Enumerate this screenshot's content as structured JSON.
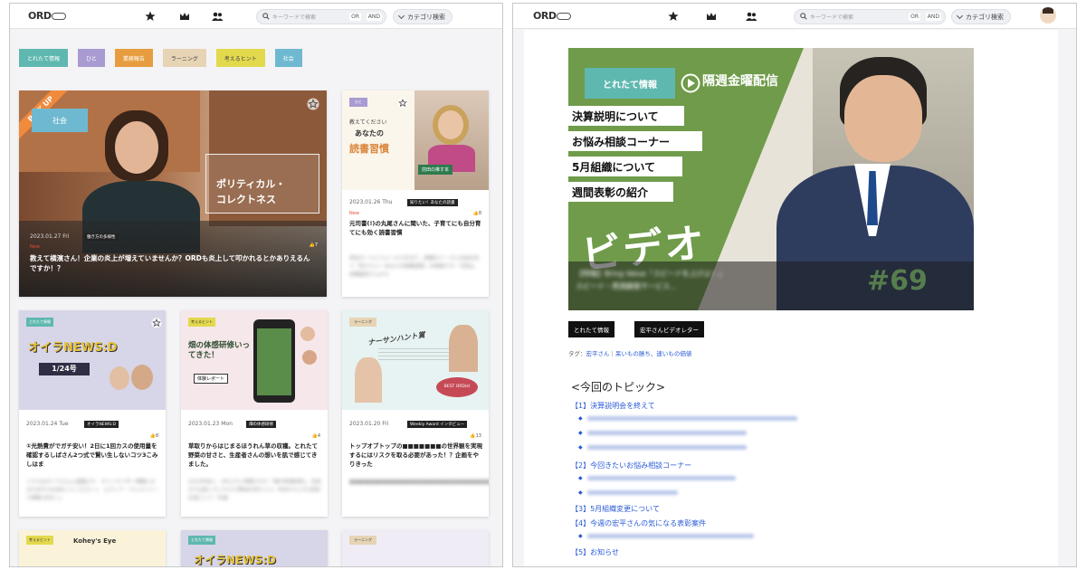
{
  "header": {
    "logo": "ORD",
    "search_placeholder": "キーワードで検索",
    "or_label": "OR",
    "and_label": "AND",
    "category_label": "カテゴリ検索"
  },
  "left": {
    "chips": [
      {
        "label": "とれたて情報",
        "color": "#5fb8b0"
      },
      {
        "label": "ひと",
        "color": "#a99bd1"
      },
      {
        "label": "業務報告",
        "color": "#e79d3f"
      },
      {
        "label": "ラーニング",
        "color": "#e7d4b5"
      },
      {
        "label": "考えるヒント",
        "color": "#e3d94d"
      },
      {
        "label": "社会",
        "color": "#6fb9d0"
      }
    ],
    "featured": {
      "pick_label": "PICK UP",
      "category": "社会",
      "thumb_text_1": "ポリティカル・",
      "thumb_text_2": "コレクトネス",
      "date": "2023.01.27 Fri",
      "tag": "働き方の多様性",
      "likes": "7",
      "new_label": "New",
      "title": "教えて横濱さん！企業の炎上が増えていませんか？ORDも炎上して叩かれるとかありえるんですか！？"
    },
    "side_card": {
      "category": "ひと",
      "thumb_text_1": "教えてください",
      "thumb_text_2": "あなたの",
      "thumb_text_3": "読書習慣",
      "thumb_badge": "前田の推す本",
      "date": "2023.01.26 Thu",
      "tag": "知りたい！あなたの読書",
      "likes": "8",
      "new_label": "New",
      "title": "元司書(!)の丸尾さんに聞いた、子育てにも自分育てにも効く読書習慣",
      "excerpt": "特定の一人にフォーカスを当て、読書をテーマにお話を伺う「知りたい！あなたの読書習慣」の時間です！今回は、高橋晶奈さんから"
    },
    "cards": [
      {
        "category": "とれたて情報",
        "thumb_title": "オイラNEWS:D",
        "thumb_sub": "1/24号",
        "date": "2023.01.24 Tue",
        "tag": "オイラNEWS:D",
        "likes": "8",
        "title": "①光熱費がでガチ安い！2日に1回カスの使用量を確認するしばさん2つ式で賢い生しないコツ3こみしはま",
        "excerpt": "こちらはオイラさんん温漏ぶり　オインサイダー情報になるためが1を含めことくださいっ　エディア・ブレスリリース情報 社内ニュ"
      },
      {
        "category": "考えるヒント",
        "thumb_title": "畑の体感研修いってきた！",
        "thumb_sub": "体験レポート",
        "date": "2023.01.23 Mon",
        "tag": "畑の体感研修",
        "likes": "4",
        "title": "草取りからはじまるほうれん草の収穫。とれたて野菜の甘さと、生産者さんの想いを肌で感じてきました。",
        "excerpt": "2022年末に、2年ぶりに再開された「畑の体感研修」。名前だけは知っていたけど興味を持ちつつ。年末からとの1回目を過ごして「生産"
      },
      {
        "category": "ラーニング",
        "thumb_title": "ナーサンハント賞",
        "thumb_sub": "BEST ORDist",
        "date": "2023.01.20 Fri",
        "tag": "Weekly Award インタビュー",
        "likes": "13",
        "title": "トップオブトップの■■■■■■■の世界観を実現するにはリスクを取る必要があった！？企画をやりきった",
        "excerpt": "■■■■■■■■■■■■■■■■■■■■■■■■■■■■■■■■■■■■■■"
      }
    ],
    "bottom_cards": [
      {
        "category": "考えるヒント",
        "thumb_title": "Kohey's Eye"
      },
      {
        "category": "とれたて情報",
        "thumb_title": "オイラNEWS:D"
      },
      {
        "category": "ラーニング",
        "thumb_title": ""
      }
    ]
  },
  "right": {
    "hero": {
      "badge": "とれたて情報",
      "schedule": "隔週金曜配信",
      "lines": [
        "決算説明について",
        "お悩み相談コーナー",
        "5月組織について",
        "週間表彰の紹介"
      ],
      "video_word": "ビデオ",
      "episode": "#69",
      "caption_line_1": "【特報】Bring Value「スピードを上げよ！」",
      "caption_line_2": "スピード・資源顧客サービス…"
    },
    "buttons": [
      "とれたて情報",
      "宏平さんビデオレター"
    ],
    "tags_label": "タグ：",
    "tags": [
      "宏平さん",
      "呆いもの勝ち、速いもの価値"
    ],
    "topics_heading": "<今回のトピック>",
    "topics": [
      {
        "label": "【1】決算説明会を終えて",
        "subs": 3
      },
      {
        "label": "【2】今回きたいお悩み相談コーナー",
        "subs": 2
      },
      {
        "label": "【3】5月組織変更について",
        "subs": 0
      },
      {
        "label": "【4】今週の宏平さんの気になる表彰案件",
        "subs": 1
      },
      {
        "label": "【5】お知らせ",
        "subs": 0
      }
    ]
  }
}
